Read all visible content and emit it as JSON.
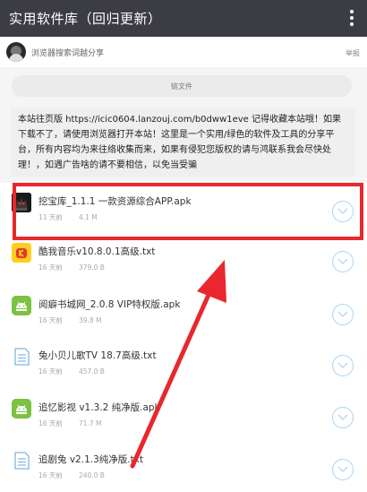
{
  "app": {
    "title": "实用软件库（回归更新）"
  },
  "user": {
    "share_text": "浏览器搜索词越分享",
    "report_label": "举报"
  },
  "folder_button_label": "链文件",
  "notice_text": "本站往页版 https://icic0604.lanzouj.com/b0dww1eve 记得收藏本站哦！如果下载不了，请使用浏览器打开本站！这里是一个实用/绿色的软件及工具的分享平台，所有内容均为来往络收集而来，如果有侵犯您版权的请与鸿联系我会尽快处理！，如遇广告啥的请不要相信，以免当受骗",
  "files": [
    {
      "name": "挖宝库_1.1.1 一款资源综合APP.apk",
      "time": "11 天前",
      "size": "4.1 M",
      "icon": "app-icon"
    },
    {
      "name": "酷我音乐v10.8.0.1高级.txt",
      "time": "16 天前",
      "size": "379.0 B",
      "icon": "music-app-icon"
    },
    {
      "name": "阅癖书城网_2.0.8 VIP特权版.apk",
      "time": "16 天前",
      "size": "39.8 M",
      "icon": "android-icon"
    },
    {
      "name": "兔小贝儿歌TV 18.7高级.txt",
      "time": "16 天前",
      "size": "457.0 B",
      "icon": "text-file-icon"
    },
    {
      "name": "追忆影视 v1.3.2 纯净版.apk",
      "time": "16 天前",
      "size": "71.7 M",
      "icon": "android-icon"
    },
    {
      "name": "追剧兔 v2.1.3纯净版.txt",
      "time": "16 天前",
      "size": "240.0 B",
      "icon": "text-file-icon"
    }
  ],
  "colors": {
    "topbar": "#3c3c44",
    "highlight": "#e8282e",
    "download_ring": "#a8d8f2"
  }
}
